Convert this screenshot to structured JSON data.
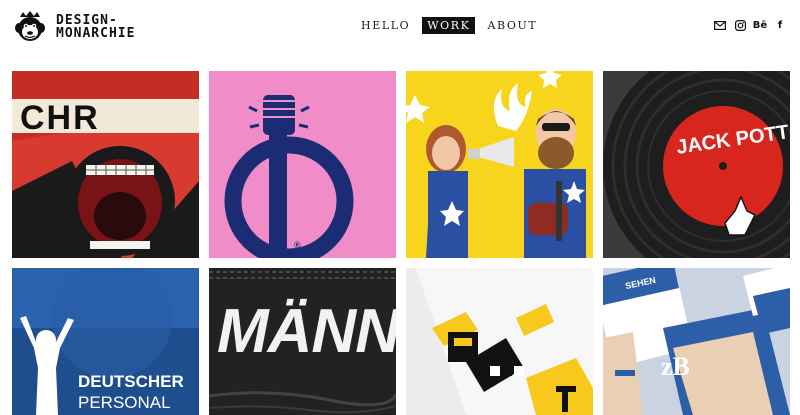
{
  "brand": {
    "line1": "DESIGN-",
    "line2": "MONARCHIE"
  },
  "nav": {
    "items": [
      {
        "label": "HELLO",
        "active": false
      },
      {
        "label": "WORK",
        "active": true
      },
      {
        "label": "ABOUT",
        "active": false
      }
    ]
  },
  "social": {
    "behance_label": "Bē",
    "facebook_label": "f"
  },
  "portfolio": {
    "tiles": [
      {
        "name": "chaos-poster",
        "text": "CHR",
        "background": "#d93a2f"
      },
      {
        "name": "fist-logo",
        "text": "®",
        "background": "#f08cc8"
      },
      {
        "name": "megaphone-photo",
        "background": "#f7d51c"
      },
      {
        "name": "vinyl-record",
        "text": "JACK POTT",
        "background": "#3b3b3b"
      },
      {
        "name": "blue-athlete",
        "text_line1": "DEUTSCHER",
        "text_line2": "PERSONAL",
        "background": "#1f4e8f"
      },
      {
        "name": "maenner-lettering",
        "text": "MÄNN",
        "background": "#222222"
      },
      {
        "name": "geometric-illustration",
        "background": "#ececec"
      },
      {
        "name": "zb-magazine",
        "text": "zB",
        "badge": "SEHEN",
        "background": "#2d5fa8"
      }
    ]
  }
}
